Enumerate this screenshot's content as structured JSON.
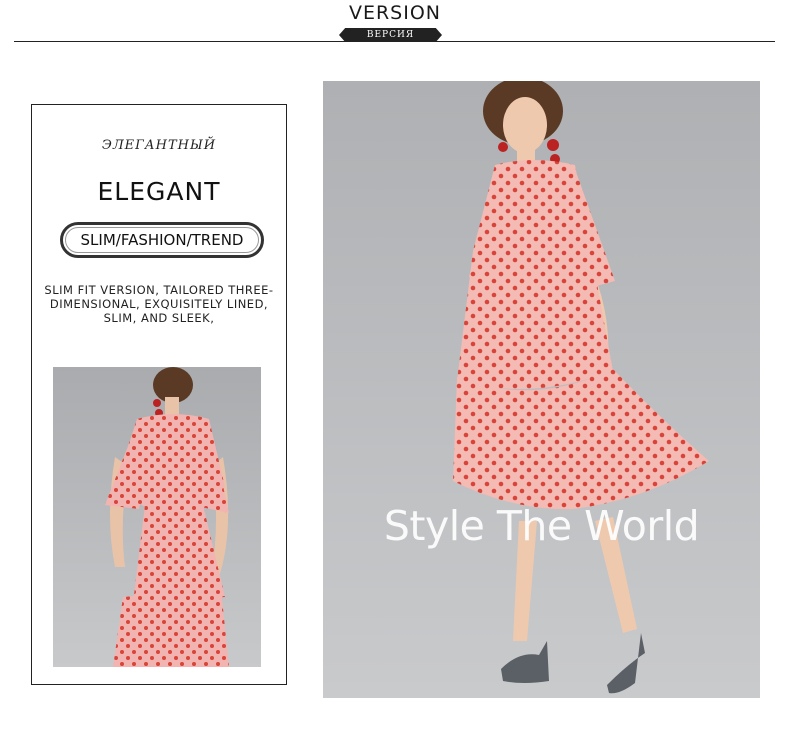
{
  "header": {
    "title": "VERSION",
    "tag": "ВЕРСИЯ"
  },
  "panel": {
    "subtitle_ru": "ЭЛЕГАНТНЫЙ",
    "title_en": "ELEGANT",
    "pill_label": "SLIM/FASHION/TREND",
    "description": "SLIM FIT VERSION, TAILORED THREE-\nDIMENSIONAL, EXQUISITELY LINED,\nSLIM, AND SLEEK,"
  },
  "photo": {
    "watermark": "Style The World"
  },
  "colors": {
    "dress_pink": "#f2b4b0",
    "dot_red": "#d9443a",
    "backdrop": "#b9bbbd"
  }
}
